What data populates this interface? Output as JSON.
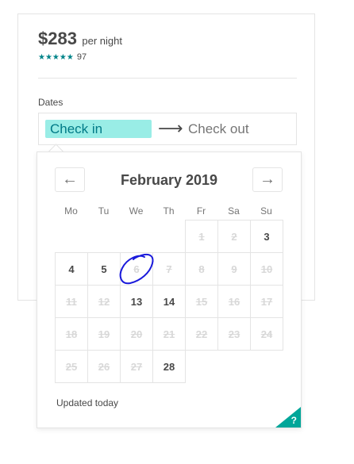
{
  "listing": {
    "price": "$283",
    "price_suffix": "per night",
    "stars": "★★★★★",
    "review_count": "97"
  },
  "dates": {
    "label": "Dates",
    "check_in": "Check in",
    "arrow": "⟶",
    "check_out": "Check out"
  },
  "calendar": {
    "prev_icon": "←",
    "next_icon": "→",
    "month": "February 2019",
    "weekdays": [
      "Mo",
      "Tu",
      "We",
      "Th",
      "Fr",
      "Sa",
      "Su"
    ],
    "days": [
      {
        "n": "1",
        "blocked": true
      },
      {
        "n": "2",
        "blocked": true
      },
      {
        "n": "3",
        "blocked": false
      },
      {
        "n": "4",
        "blocked": false
      },
      {
        "n": "5",
        "blocked": false
      },
      {
        "n": "6",
        "blocked": true
      },
      {
        "n": "7",
        "blocked": true
      },
      {
        "n": "8",
        "blocked": true
      },
      {
        "n": "9",
        "blocked": true
      },
      {
        "n": "10",
        "blocked": true
      },
      {
        "n": "11",
        "blocked": true
      },
      {
        "n": "12",
        "blocked": true
      },
      {
        "n": "13",
        "blocked": false
      },
      {
        "n": "14",
        "blocked": false
      },
      {
        "n": "15",
        "blocked": true
      },
      {
        "n": "16",
        "blocked": true
      },
      {
        "n": "17",
        "blocked": true
      },
      {
        "n": "18",
        "blocked": true
      },
      {
        "n": "19",
        "blocked": true
      },
      {
        "n": "20",
        "blocked": true
      },
      {
        "n": "21",
        "blocked": true
      },
      {
        "n": "22",
        "blocked": true
      },
      {
        "n": "23",
        "blocked": true
      },
      {
        "n": "24",
        "blocked": true
      },
      {
        "n": "25",
        "blocked": true
      },
      {
        "n": "26",
        "blocked": true
      },
      {
        "n": "27",
        "blocked": true
      },
      {
        "n": "28",
        "blocked": false
      }
    ],
    "first_weekday_index": 4,
    "updated": "Updated today",
    "help": "?"
  },
  "colors": {
    "accent": "#00a699",
    "highlight": "#99ede6",
    "annotation": "#1a1adb"
  }
}
